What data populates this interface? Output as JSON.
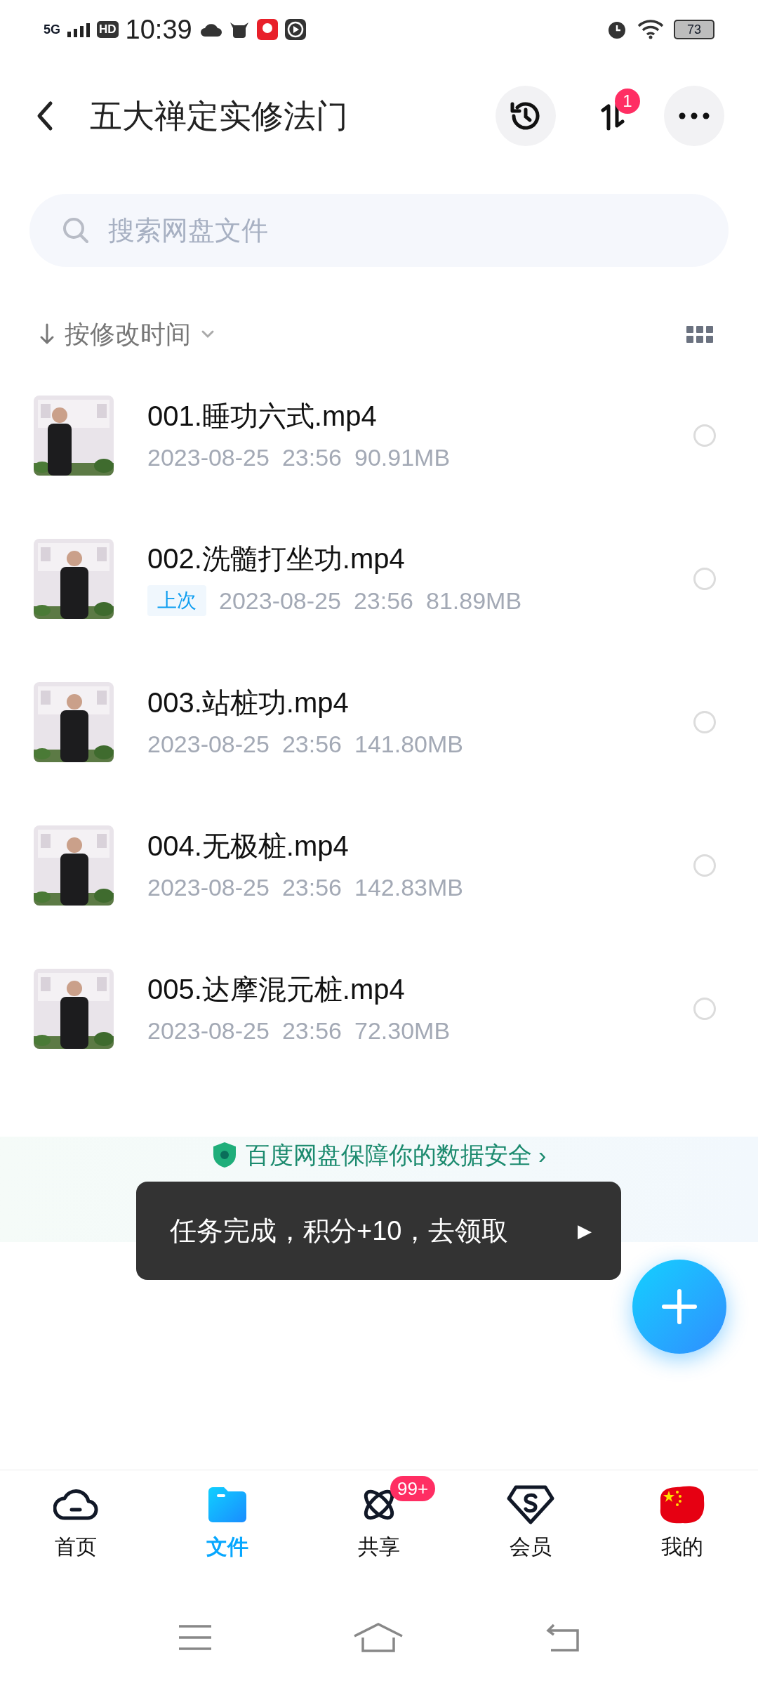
{
  "status_bar": {
    "network": "5G",
    "hd": "HD",
    "time": "10:39",
    "battery": "73"
  },
  "header": {
    "title": "五大禅定实修法门",
    "transfer_badge": "1"
  },
  "search": {
    "placeholder": "搜索网盘文件"
  },
  "sort": {
    "label": "按修改时间"
  },
  "files": [
    {
      "name": "001.睡功六式.mp4",
      "date": "2023-08-25",
      "time": "23:56",
      "size": "90.91MB",
      "checked": false
    },
    {
      "name": "002.洗髓打坐功.mp4",
      "tag": "上次",
      "date": "2023-08-25",
      "time": "23:56",
      "size": "81.89MB",
      "checked": false
    },
    {
      "name": "003.站桩功.mp4",
      "date": "2023-08-25",
      "time": "23:56",
      "size": "141.80MB",
      "checked": false
    },
    {
      "name": "004.无极桩.mp4",
      "date": "2023-08-25",
      "time": "23:56",
      "size": "142.83MB",
      "checked": false
    },
    {
      "name": "005.达摩混元桩.mp4",
      "date": "2023-08-25",
      "time": "23:56",
      "size": "72.30MB",
      "checked": false
    }
  ],
  "security_banner": {
    "text": "百度网盘保障你的数据安全 ›"
  },
  "toast": {
    "text": "任务完成，积分+10，去领取",
    "arrow": "▶"
  },
  "tabs": [
    {
      "kind": "home",
      "label": "首页",
      "selected": false
    },
    {
      "kind": "files",
      "label": "文件",
      "selected": true
    },
    {
      "kind": "share",
      "label": "共享",
      "selected": false,
      "badge": "99+"
    },
    {
      "kind": "vip",
      "label": "会员",
      "selected": false
    },
    {
      "kind": "me",
      "label": "我的",
      "selected": false
    }
  ]
}
